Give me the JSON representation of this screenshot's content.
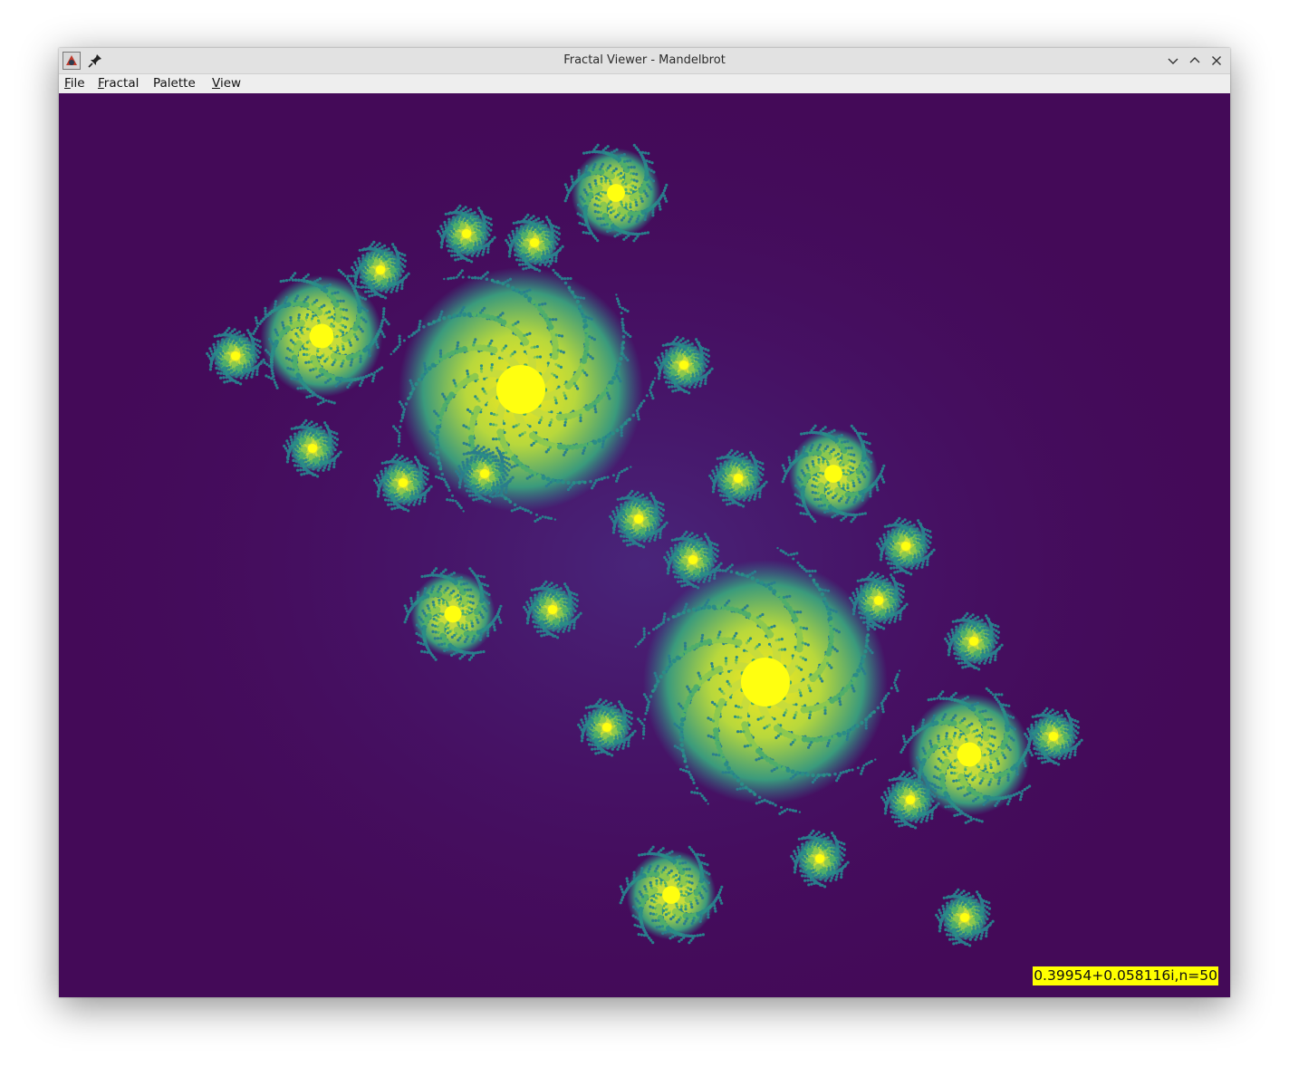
{
  "window": {
    "title": "Fractal Viewer - Mandelbrot"
  },
  "icons": {
    "app": "java-app-icon",
    "pin": "pin-icon",
    "minimize": "chevron-down-icon",
    "maximize": "chevron-up-icon",
    "close": "close-icon"
  },
  "menubar": {
    "items": [
      {
        "label": "File",
        "mnemonic": "F"
      },
      {
        "label": "Fractal",
        "mnemonic": "F"
      },
      {
        "label": "Palette",
        "mnemonic": ""
      },
      {
        "label": "View",
        "mnemonic": "V"
      }
    ]
  },
  "canvas": {
    "fractal": "Julia set",
    "palette": [
      "#440a58",
      "#2a7d8c",
      "#74c46a",
      "#f7e516"
    ],
    "background_color": "#440a58"
  },
  "readout": {
    "text": "0.39954+0.058116i,n=50"
  }
}
